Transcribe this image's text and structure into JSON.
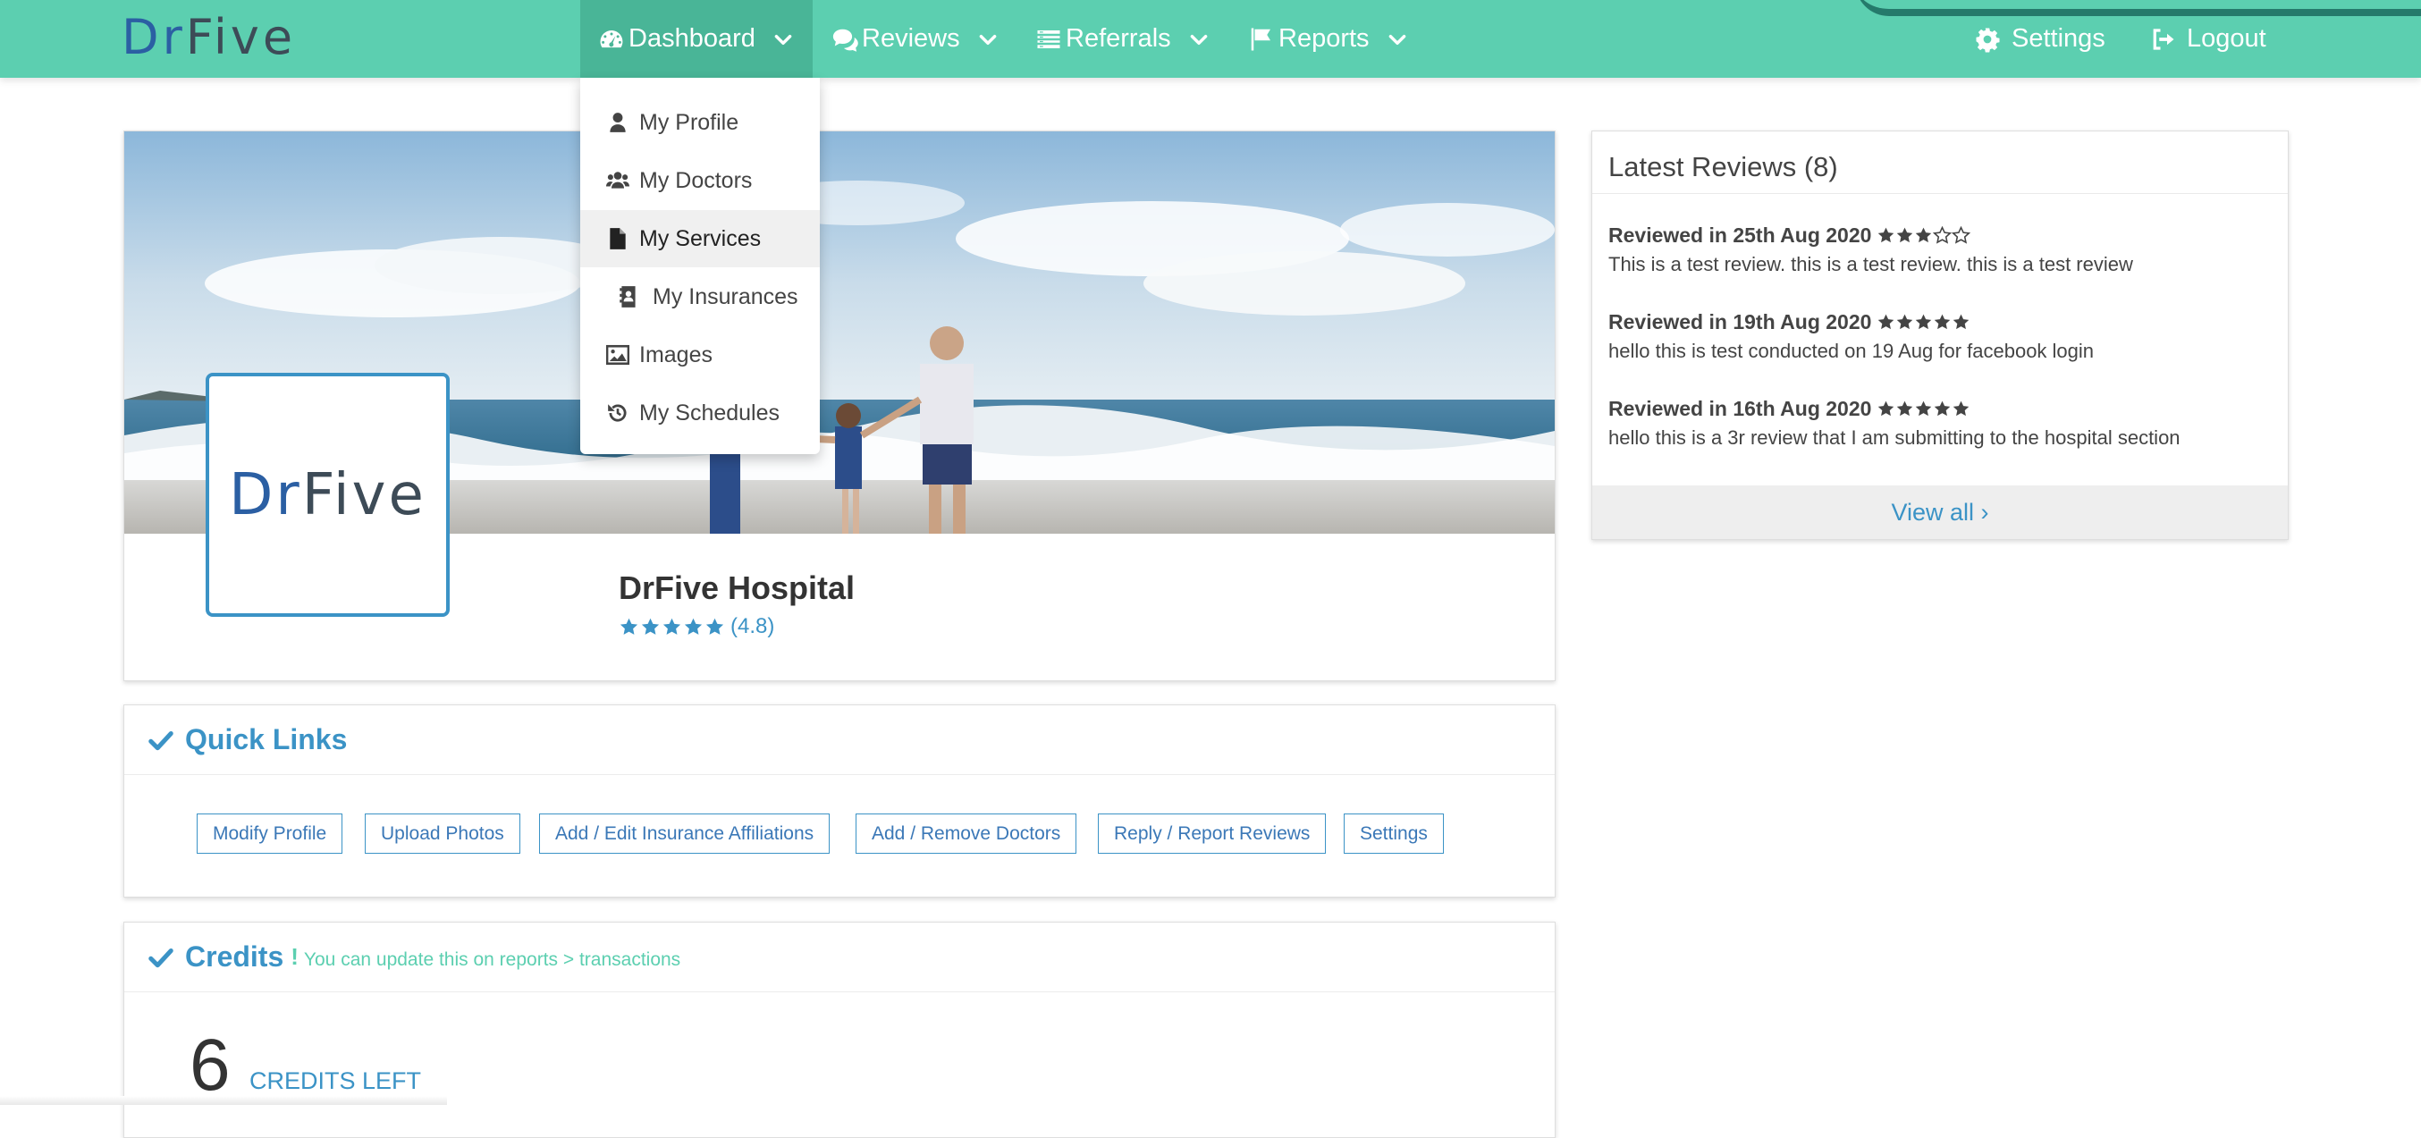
{
  "app": {
    "logo_dr": "Dr",
    "logo_five": "Five"
  },
  "nav": {
    "dashboard": "Dashboard",
    "reviews": "Reviews",
    "referrals": "Referrals",
    "reports": "Reports",
    "settings": "Settings",
    "logout": "Logout",
    "active": "Dashboard"
  },
  "dropdown": {
    "items": [
      {
        "label": "My Profile",
        "icon": "user-icon"
      },
      {
        "label": "My Doctors",
        "icon": "users-icon"
      },
      {
        "label": "My Services",
        "icon": "file-icon",
        "state": "hover"
      },
      {
        "label": "My Insurances",
        "icon": "insurance-icon"
      },
      {
        "label": "Images",
        "icon": "image-icon"
      },
      {
        "label": "My Schedules",
        "icon": "history-icon"
      }
    ]
  },
  "profile": {
    "logo_dr": "Dr",
    "logo_five": "Five",
    "name": "DrFive Hospital",
    "rating_text": "(4.8)",
    "rating_value": 4.8,
    "rating_max": 5
  },
  "quick_links": {
    "title": "Quick Links",
    "buttons": [
      "Modify Profile",
      "Upload Photos",
      "Add / Edit Insurance Affiliations",
      "Add / Remove Doctors",
      "Reply / Report Reviews",
      "Settings"
    ]
  },
  "credits": {
    "title": "Credits",
    "excl": "!",
    "note": "You can update this on reports > transactions",
    "count": "6",
    "label": "CREDITS LEFT"
  },
  "latest_reviews": {
    "title": "Latest Reviews (8)",
    "reviews": [
      {
        "heading": "Reviewed in 25th Aug 2020",
        "stars": 3,
        "text": "This is a test review. this is a test review. this is a test review"
      },
      {
        "heading": "Reviewed in 19th Aug 2020",
        "stars": 5,
        "text": "hello this is test conducted on 19 Aug for facebook login"
      },
      {
        "heading": "Reviewed in 16th Aug 2020",
        "stars": 5,
        "text": "hello this is a 3r review that I am submitting to the hospital section"
      }
    ],
    "view_all": "View all ›"
  },
  "colors": {
    "nav_bg": "#5ccfb0",
    "nav_active": "#49b597",
    "accent_blue": "#3b93c6",
    "accent_green": "#5ccfb0"
  }
}
